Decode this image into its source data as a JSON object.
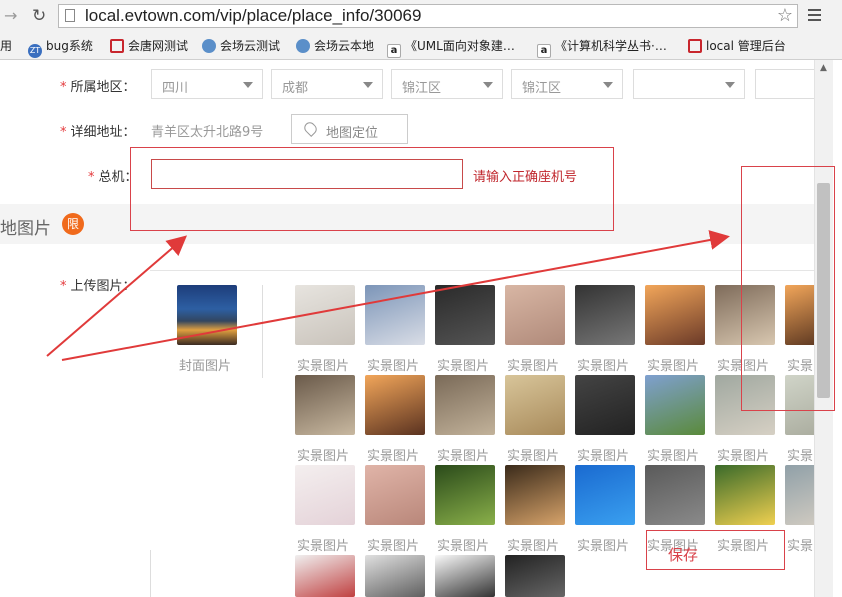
{
  "browser": {
    "url": "local.evtown.com/vip/place/place_info/30069",
    "bookmarks": [
      {
        "label": "应用",
        "icon": "apps-icon"
      },
      {
        "label": "bug系统",
        "icon": "zt-icon"
      },
      {
        "label": "会唐网测试",
        "icon": "site-icon"
      },
      {
        "label": "会场云测试",
        "icon": "cloud-icon"
      },
      {
        "label": "会场云本地",
        "icon": "cloud-icon"
      },
      {
        "label": "《UML面向对象建…",
        "icon": "amazon-icon"
      },
      {
        "label": "《计算机科学丛书·…",
        "icon": "amazon-icon"
      },
      {
        "label": "local 管理后台",
        "icon": "site-icon"
      }
    ]
  },
  "form": {
    "region_label": "所属地区：",
    "region_selects": [
      "四川",
      "成都",
      "锦江区",
      "锦江区",
      "",
      ""
    ],
    "address_label": "详细地址：",
    "address_value": "青羊区太升北路9号",
    "map_button": "地图定位",
    "phone_label": "总机：",
    "phone_value": "",
    "phone_error": "请输入正确座机号",
    "required_mark": "*"
  },
  "section": {
    "title": "地图片",
    "badge": "限"
  },
  "upload": {
    "label": "上传图片：",
    "cover_label": "封面图片",
    "photo_label": "实景图片",
    "save_label": "保存"
  },
  "colors": {
    "accent_red": "#e4393c",
    "badge_orange": "#f06a1c",
    "annotation_red": "#e03a3a"
  }
}
